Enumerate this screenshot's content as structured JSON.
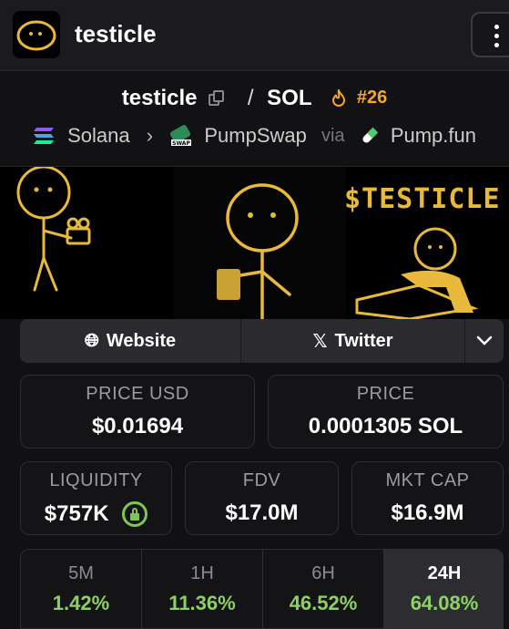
{
  "header": {
    "title": "testicle",
    "menu_icon": "kebab-menu-icon"
  },
  "pair": {
    "base": "testicle",
    "separator": "/",
    "quote": "SOL",
    "rank": "#26",
    "chain": "Solana",
    "dex": "PumpSwap",
    "via_label": "via",
    "launchpad": "Pump.fun"
  },
  "banner": {
    "text": "$TESTICLE"
  },
  "social": {
    "website_label": "Website",
    "twitter_label": "Twitter"
  },
  "stats": {
    "price_usd_label": "PRICE USD",
    "price_usd": "$0.01694",
    "price_label": "PRICE",
    "price": "0.0001305 SOL",
    "liquidity_label": "LIQUIDITY",
    "liquidity": "$757K",
    "fdv_label": "FDV",
    "fdv": "$17.0M",
    "mktcap_label": "MKT CAP",
    "mktcap": "$16.9M"
  },
  "changes": [
    {
      "label": "5M",
      "value": "1.42%"
    },
    {
      "label": "1H",
      "value": "11.36%"
    },
    {
      "label": "6H",
      "value": "46.52%"
    },
    {
      "label": "24H",
      "value": "64.08%"
    }
  ],
  "colors": {
    "accent_orange": "#f5a623",
    "positive_green": "#8dd164",
    "banner_yellow": "#e8b93a"
  }
}
